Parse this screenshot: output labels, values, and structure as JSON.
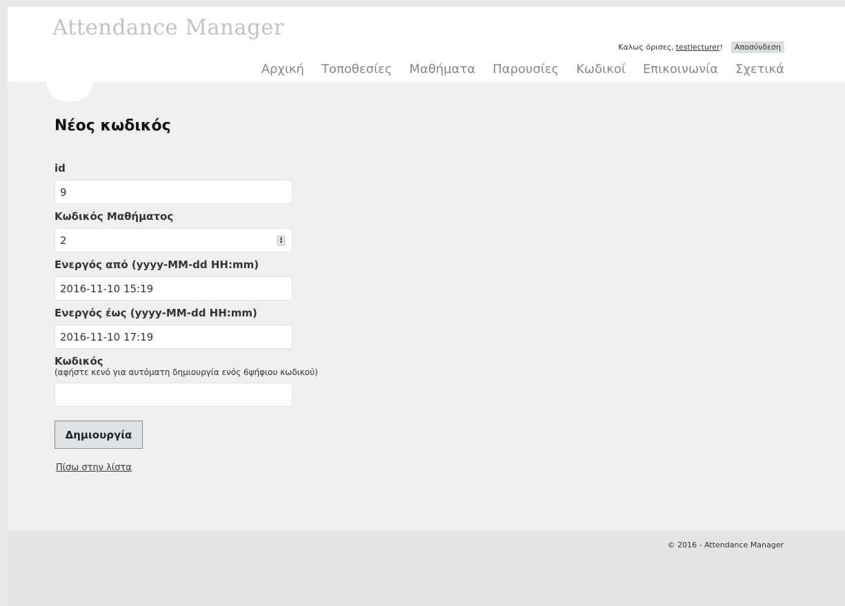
{
  "header": {
    "logo": "Attendance Manager",
    "greeting": "Καλως όρισες,",
    "username": "testlecturer",
    "greeting_suffix": "!",
    "logout": "Αποσύνδεση"
  },
  "nav": {
    "items": [
      "Αρχική",
      "Τοποθεσίες",
      "Μαθήματα",
      "Παρουσίες",
      "Κωδικοί",
      "Επικοινωνία",
      "Σχετικά"
    ]
  },
  "main": {
    "title": "Νέος κωδικός",
    "fields": [
      {
        "label": "id",
        "value": "9"
      },
      {
        "label": "Κωδικός Μαθήματος",
        "value": "2"
      },
      {
        "label": "Ενεργός από (yyyy-MM-dd HH:mm)",
        "value": "2016-11-10 15:19"
      },
      {
        "label": "Ενεργός έως (yyyy-MM-dd HH:mm)",
        "value": "2016-11-10 17:19"
      },
      {
        "label": "Κωδικός",
        "hint": "(αφήστε κενό για αυτόματη δημιουργία ενός 6ψήφιου κωδικού)",
        "value": ""
      }
    ],
    "create_button": "Δημιουργία",
    "back_link": "Πίσω στην λίστα"
  },
  "footer": {
    "text": "© 2016 - Attendance Manager"
  }
}
